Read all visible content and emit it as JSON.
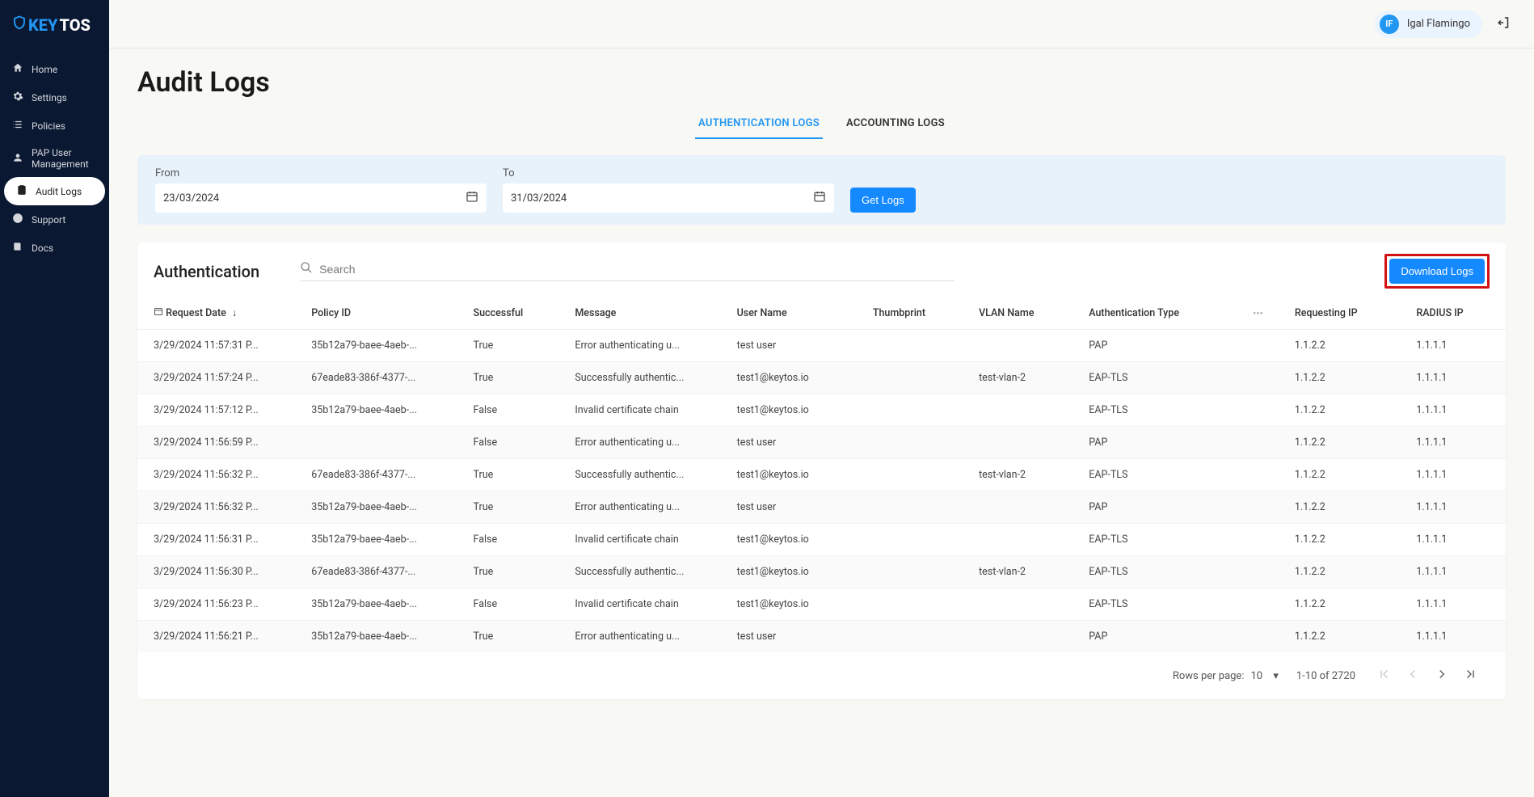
{
  "app": {
    "logo_key": "KEY",
    "logo_tos": "TOS"
  },
  "user": {
    "initials": "IF",
    "name": "Igal Flamingo"
  },
  "sidebar": {
    "items": [
      {
        "label": "Home",
        "icon": "home"
      },
      {
        "label": "Settings",
        "icon": "gear"
      },
      {
        "label": "Policies",
        "icon": "list"
      },
      {
        "label": "PAP User Management",
        "icon": "user"
      },
      {
        "label": "Audit Logs",
        "icon": "clipboard",
        "active": true
      },
      {
        "label": "Support",
        "icon": "globe"
      },
      {
        "label": "Docs",
        "icon": "book"
      }
    ]
  },
  "page": {
    "title": "Audit Logs",
    "tabs": [
      {
        "label": "AUTHENTICATION LOGS",
        "active": true
      },
      {
        "label": "ACCOUNTING LOGS",
        "active": false
      }
    ]
  },
  "filter": {
    "from_label": "From",
    "from_value": "23/03/2024",
    "to_label": "To",
    "to_value": "31/03/2024",
    "button": "Get Logs"
  },
  "panel": {
    "title": "Authentication",
    "search_placeholder": "Search",
    "download": "Download Logs"
  },
  "columns": [
    "Request Date",
    "Policy ID",
    "Successful",
    "Message",
    "User Name",
    "Thumbprint",
    "VLAN Name",
    "Authentication Type",
    "Requesting IP",
    "RADIUS IP"
  ],
  "rows": [
    {
      "date": "3/29/2024 11:57:31 P...",
      "policy": "35b12a79-baee-4aeb-...",
      "successful": "True",
      "message": "Error authenticating u...",
      "user": "test user",
      "thumbprint": "",
      "vlan": "",
      "authType": "PAP",
      "reqIp": "1.1.2.2",
      "radiusIp": "1.1.1.1"
    },
    {
      "date": "3/29/2024 11:57:24 P...",
      "policy": "67eade83-386f-4377-...",
      "successful": "True",
      "message": "Successfully authentic...",
      "user": "test1@keytos.io",
      "thumbprint": "",
      "vlan": "test-vlan-2",
      "authType": "EAP-TLS",
      "reqIp": "1.1.2.2",
      "radiusIp": "1.1.1.1"
    },
    {
      "date": "3/29/2024 11:57:12 P...",
      "policy": "35b12a79-baee-4aeb-...",
      "successful": "False",
      "message": "Invalid certificate chain",
      "user": "test1@keytos.io",
      "thumbprint": "",
      "vlan": "",
      "authType": "EAP-TLS",
      "reqIp": "1.1.2.2",
      "radiusIp": "1.1.1.1"
    },
    {
      "date": "3/29/2024 11:56:59 P...",
      "policy": "",
      "successful": "False",
      "message": "Error authenticating u...",
      "user": "test user",
      "thumbprint": "",
      "vlan": "",
      "authType": "PAP",
      "reqIp": "1.1.2.2",
      "radiusIp": "1.1.1.1"
    },
    {
      "date": "3/29/2024 11:56:32 P...",
      "policy": "67eade83-386f-4377-...",
      "successful": "True",
      "message": "Successfully authentic...",
      "user": "test1@keytos.io",
      "thumbprint": "",
      "vlan": "test-vlan-2",
      "authType": "EAP-TLS",
      "reqIp": "1.1.2.2",
      "radiusIp": "1.1.1.1"
    },
    {
      "date": "3/29/2024 11:56:32 P...",
      "policy": "35b12a79-baee-4aeb-...",
      "successful": "True",
      "message": "Error authenticating u...",
      "user": "test user",
      "thumbprint": "",
      "vlan": "",
      "authType": "PAP",
      "reqIp": "1.1.2.2",
      "radiusIp": "1.1.1.1"
    },
    {
      "date": "3/29/2024 11:56:31 P...",
      "policy": "35b12a79-baee-4aeb-...",
      "successful": "False",
      "message": "Invalid certificate chain",
      "user": "test1@keytos.io",
      "thumbprint": "",
      "vlan": "",
      "authType": "EAP-TLS",
      "reqIp": "1.1.2.2",
      "radiusIp": "1.1.1.1"
    },
    {
      "date": "3/29/2024 11:56:30 P...",
      "policy": "67eade83-386f-4377-...",
      "successful": "True",
      "message": "Successfully authentic...",
      "user": "test1@keytos.io",
      "thumbprint": "",
      "vlan": "test-vlan-2",
      "authType": "EAP-TLS",
      "reqIp": "1.1.2.2",
      "radiusIp": "1.1.1.1"
    },
    {
      "date": "3/29/2024 11:56:23 P...",
      "policy": "35b12a79-baee-4aeb-...",
      "successful": "False",
      "message": "Invalid certificate chain",
      "user": "test1@keytos.io",
      "thumbprint": "",
      "vlan": "",
      "authType": "EAP-TLS",
      "reqIp": "1.1.2.2",
      "radiusIp": "1.1.1.1"
    },
    {
      "date": "3/29/2024 11:56:21 P...",
      "policy": "35b12a79-baee-4aeb-...",
      "successful": "True",
      "message": "Error authenticating u...",
      "user": "test user",
      "thumbprint": "",
      "vlan": "",
      "authType": "PAP",
      "reqIp": "1.1.2.2",
      "radiusIp": "1.1.1.1"
    }
  ],
  "pagination": {
    "rows_label": "Rows per page:",
    "rows_value": "10",
    "range": "1-10 of 2720"
  }
}
